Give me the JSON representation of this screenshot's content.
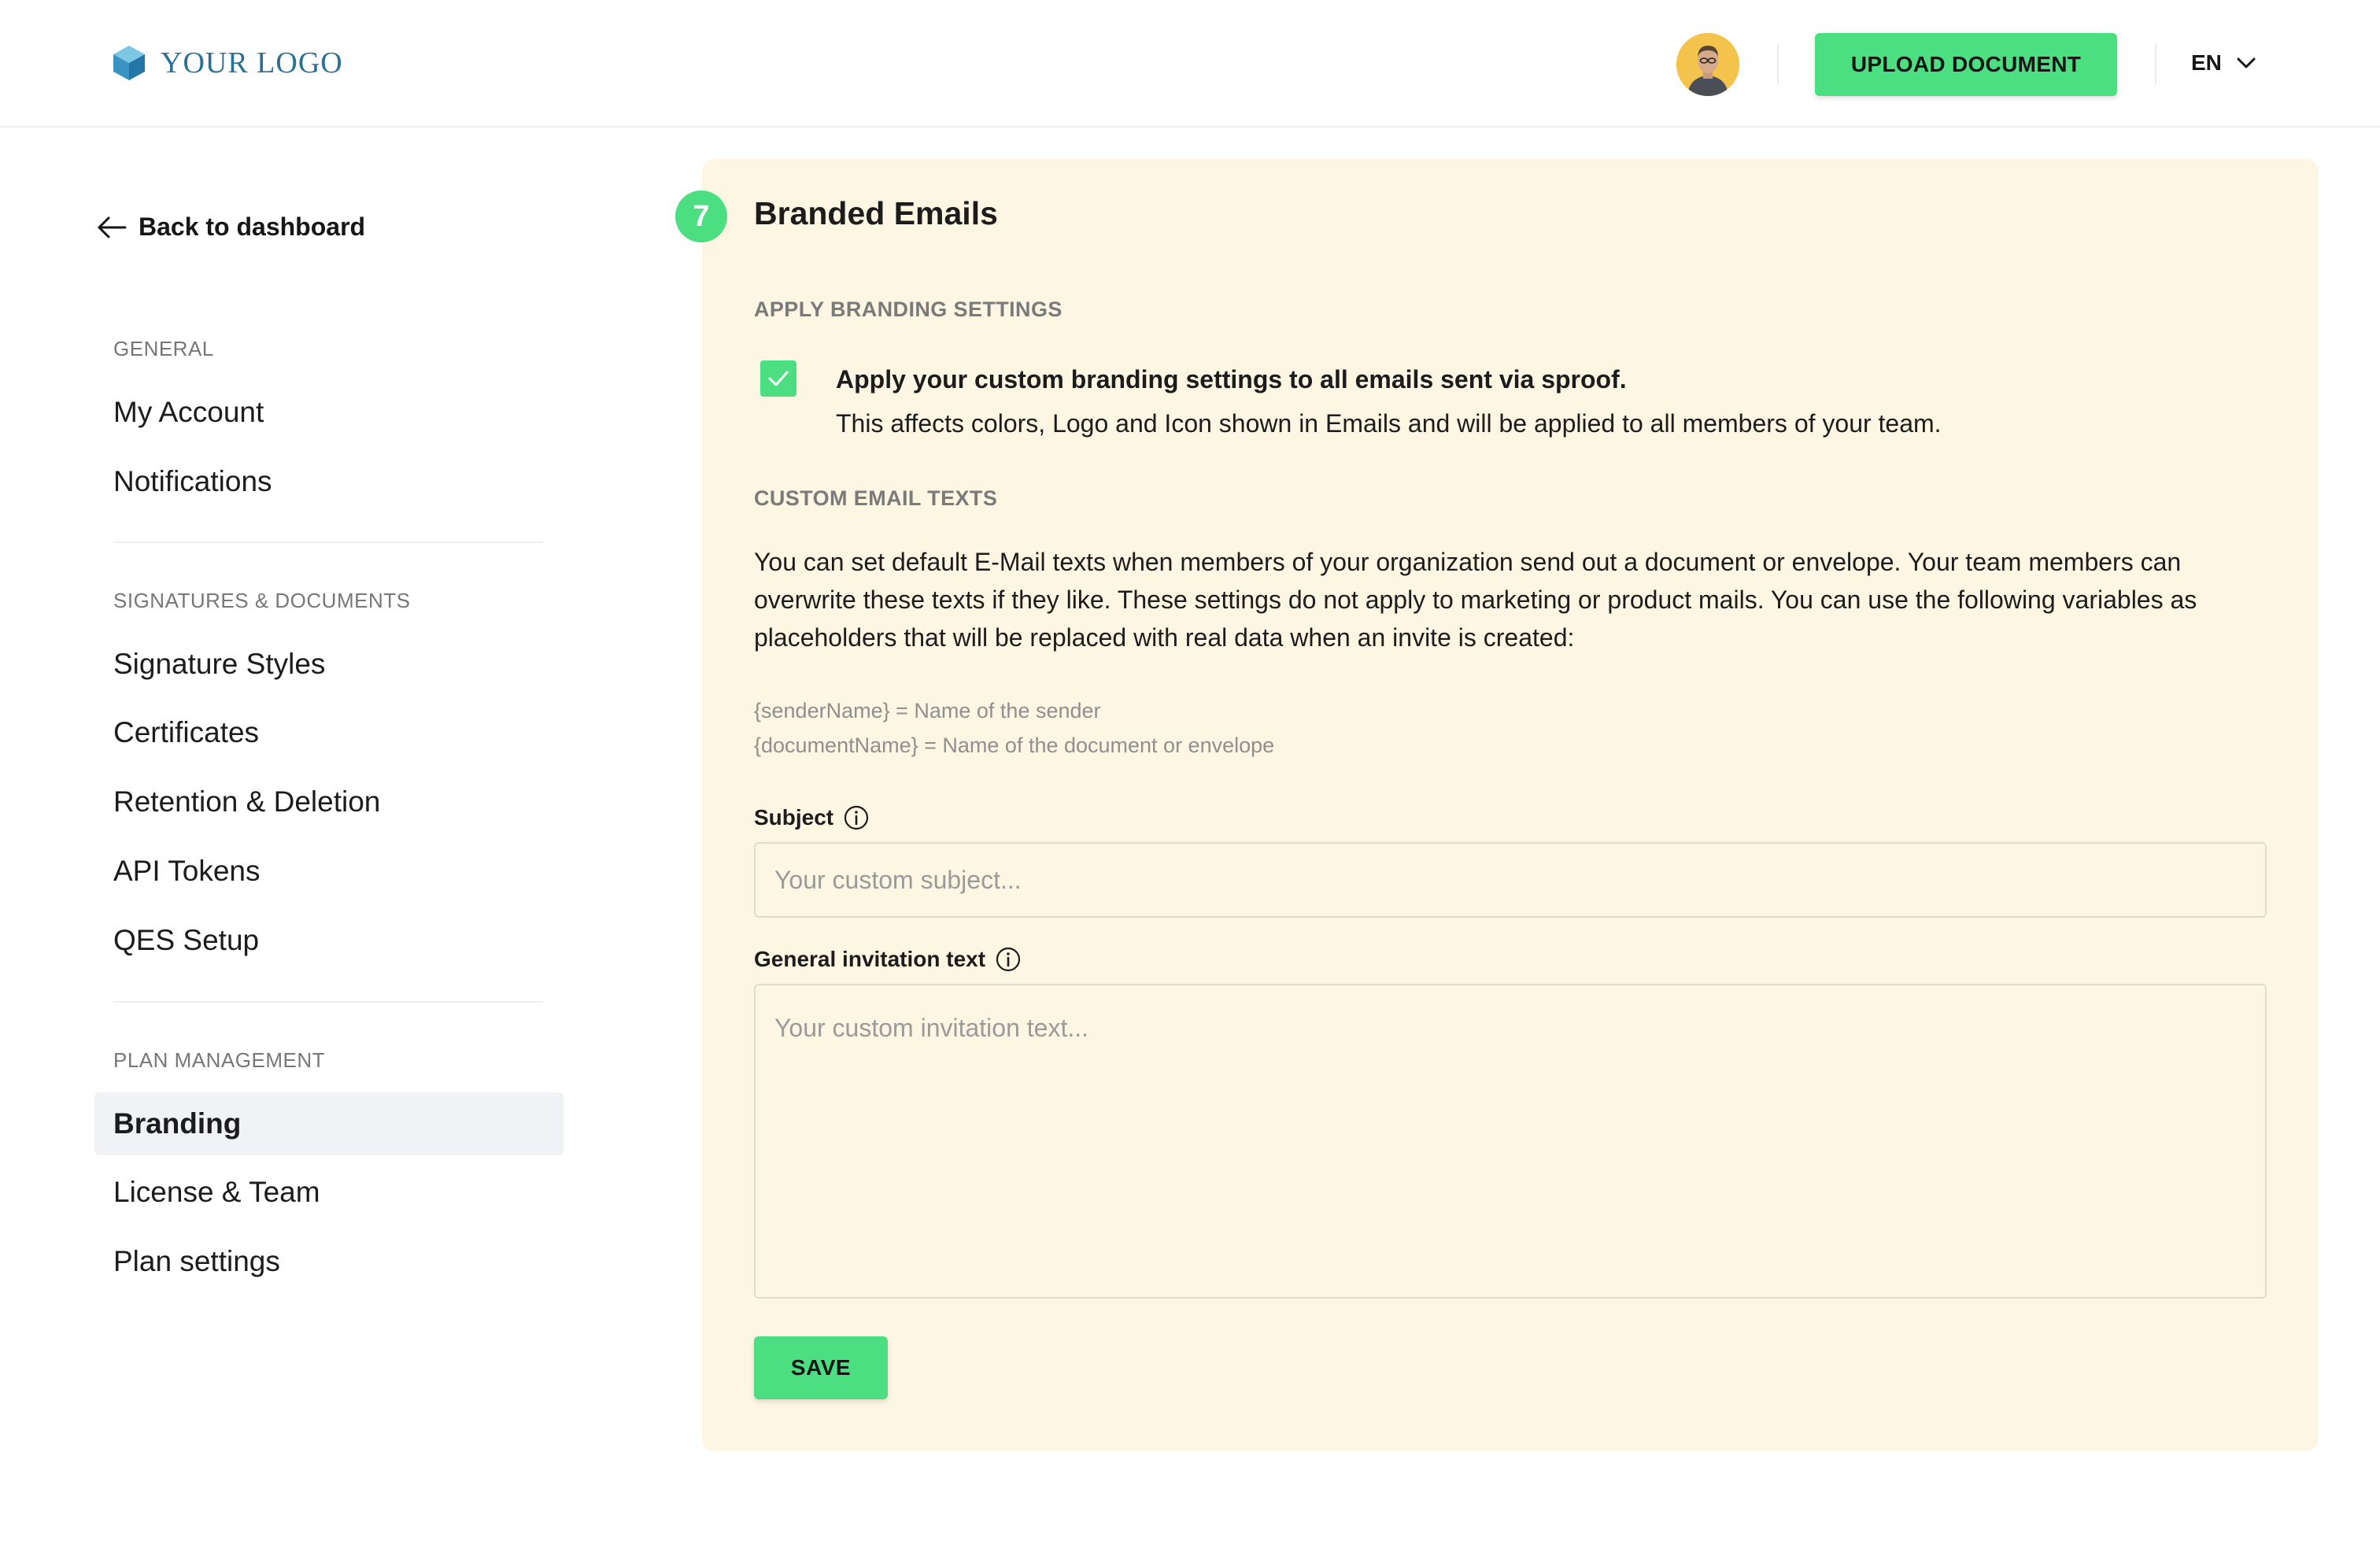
{
  "header": {
    "logo_text": "YOUR LOGO",
    "upload_button": "UPLOAD DOCUMENT",
    "language": "EN"
  },
  "sidebar": {
    "back_label": "Back to dashboard",
    "sections": [
      {
        "label": "GENERAL",
        "items": [
          "My Account",
          "Notifications"
        ]
      },
      {
        "label": "SIGNATURES & DOCUMENTS",
        "items": [
          "Signature Styles",
          "Certificates",
          "Retention & Deletion",
          "API Tokens",
          "QES Setup"
        ]
      },
      {
        "label": "PLAN MANAGEMENT",
        "items": [
          "Branding",
          "License & Team",
          "Plan settings"
        ]
      }
    ],
    "active_item": "Branding"
  },
  "main": {
    "step_number": "7",
    "title": "Branded Emails",
    "apply_section_label": "APPLY BRANDING SETTINGS",
    "apply_checkbox": {
      "checked": true,
      "title": "Apply your custom branding settings to all emails sent via sproof.",
      "description": "This affects colors, Logo and Icon shown in Emails and will be applied to all members of your team."
    },
    "custom_texts_label": "CUSTOM EMAIL TEXTS",
    "description": "You can set default E-Mail texts when members of your organization send out a document or envelope. Your team members can overwrite these texts if they like. These settings do not apply to marketing or product mails. You can use the following variables as placeholders that will be replaced with real data when an invite is created:",
    "variables": [
      "{senderName} = Name of the sender",
      "{documentName} = Name of the document or envelope"
    ],
    "subject": {
      "label": "Subject",
      "value": "",
      "placeholder": "Your custom subject..."
    },
    "invitation": {
      "label": "General invitation text",
      "value": "",
      "placeholder": "Your custom invitation text..."
    },
    "save_button": "SAVE"
  },
  "colors": {
    "accent": "#4cdf82",
    "card_background": "#fdf6e3",
    "logo_blue": "#2b6f96",
    "active_nav_background": "#f1f2f5"
  },
  "icons": [
    "logo-cube-icon",
    "user-avatar",
    "chevron-down-icon",
    "arrow-left-icon",
    "checkmark-icon",
    "info-icon"
  ]
}
